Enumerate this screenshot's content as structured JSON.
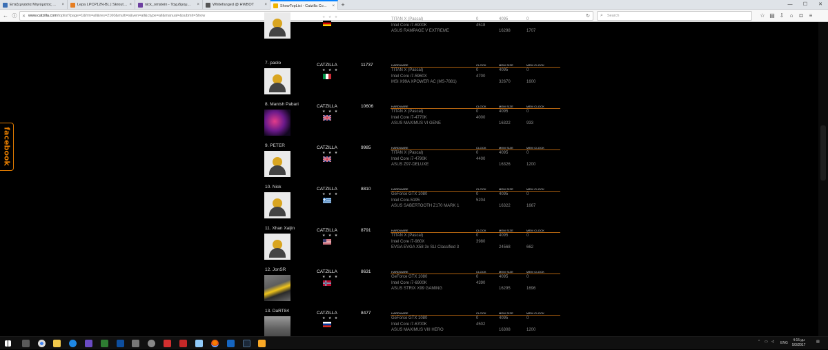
{
  "browser": {
    "tabs": [
      {
        "title": "Επεξεργασία Μηνύματος ...",
        "color": "#3b6fb5"
      },
      {
        "title": "Lepa LPCP12N-BL | Skroutz...",
        "color": "#e67e22"
      },
      {
        "title": "nick_ornstein - Ταχυδρομ...",
        "color": "#6d3fa0"
      },
      {
        "title": "Whitefanged @ HWBOT",
        "color": "#555555"
      },
      {
        "title": "ShowTopList - Catzilla Co...",
        "color": "#f0b400"
      }
    ],
    "url_domain": "www.catzilla.com",
    "url_rest": "/toplist?page=1&frm=all&res=2160&multi=s&ven=all&ctype=all&manual=&submit=Show",
    "search_placeholder": "Search"
  },
  "facebook_tab_label": "facebook",
  "spec_headers": {
    "hardware": "HARDWARE",
    "clock": "CLOCK",
    "mem_size": "MEM SIZE",
    "mem_clock": "MEM CLOCK"
  },
  "stars": "★ ★ ★",
  "entries": [
    {
      "user": "",
      "team": "",
      "score": "",
      "flag": "de",
      "avatar": "default",
      "show_header": false,
      "rows": [
        [
          "TITAN X (Pascal)",
          "0",
          "4095",
          "0"
        ],
        [
          "Intel Core i7-6900K",
          "4518",
          "",
          ""
        ],
        [
          "ASUS RAMPAGE V EXTREME",
          "",
          "16298",
          "1707"
        ]
      ]
    },
    {
      "user": "7. paolo",
      "team": "CATZILLA",
      "score": "11737",
      "flag": "it",
      "avatar": "default",
      "show_header": true,
      "rows": [
        [
          "TITAN X (Pascal)",
          "0",
          "4095",
          "0"
        ],
        [
          "Intel Core i7-5960X",
          "4700",
          "",
          ""
        ],
        [
          "MSI X99A XPOWER AC (MS-7881)",
          "",
          "32670",
          "1600"
        ]
      ]
    },
    {
      "user": "8. Manish Pabari",
      "team": "CATZILLA",
      "score": "10606",
      "flag": "uk",
      "avatar": "horse",
      "show_header": true,
      "rows": [
        [
          "TITAN X (Pascal)",
          "0",
          "4095",
          "0"
        ],
        [
          "Intel Core i7-4770K",
          "4000",
          "",
          ""
        ],
        [
          "ASUS MAXIMUS VI GENE",
          "",
          "16322",
          "933"
        ]
      ]
    },
    {
      "user": "9. PETER",
      "team": "CATZILLA",
      "score": "9985",
      "flag": "uk",
      "avatar": "default",
      "show_header": true,
      "rows": [
        [
          "TITAN X (Pascal)",
          "0",
          "4095",
          "0"
        ],
        [
          "Intel Core i7-4790K",
          "4400",
          "",
          ""
        ],
        [
          "ASUS Z97-DELUXE",
          "",
          "16326",
          "1200"
        ]
      ]
    },
    {
      "user": "10. Nick",
      "team": "CATZILLA",
      "score": "8810",
      "flag": "gr",
      "avatar": "default",
      "show_header": true,
      "rows": [
        [
          "GeForce GTX 1080",
          "0",
          "4095",
          "0"
        ],
        [
          "Intel Core-5195",
          "5204",
          "",
          ""
        ],
        [
          "ASUS SABERTOOTH Z170 MARK 1",
          "",
          "16322",
          "1667"
        ]
      ]
    },
    {
      "user": "11. Xhan Xaijin",
      "team": "CATZILLA",
      "score": "8791",
      "flag": "us",
      "avatar": "default",
      "show_header": true,
      "rows": [
        [
          "TITAN X (Pascal)",
          "0",
          "4095",
          "0"
        ],
        [
          "Intel Core i7-980X",
          "3980",
          "",
          ""
        ],
        [
          "EVGA EVGA X58 3x SLI Classified 3",
          "",
          "24568",
          "662"
        ]
      ]
    },
    {
      "user": "12. JonSR",
      "team": "CATZILLA",
      "score": "8631",
      "flag": "no",
      "avatar": "car",
      "show_header": true,
      "rows": [
        [
          "GeForce GTX 1080",
          "0",
          "4095",
          "0"
        ],
        [
          "Intel Core i7-6900K",
          "4390",
          "",
          ""
        ],
        [
          "ASUS STRIX X99 GAMING",
          "",
          "16295",
          "1696"
        ]
      ]
    },
    {
      "user": "13. DaRT84",
      "team": "CATZILLA",
      "score": "8477",
      "flag": "ru",
      "avatar": "bw",
      "show_header": true,
      "rows": [
        [
          "GeForce GTX 1080",
          "0",
          "4095",
          "0"
        ],
        [
          "Intel Core i7-6700K",
          "4502",
          "",
          ""
        ],
        [
          "ASUS MAXIMUS VIII HERO",
          "",
          "16308",
          "1200"
        ]
      ]
    }
  ],
  "taskbar": {
    "tray_lang": "ENG",
    "time": "4:15 μμ",
    "date": "5/3/2017"
  }
}
